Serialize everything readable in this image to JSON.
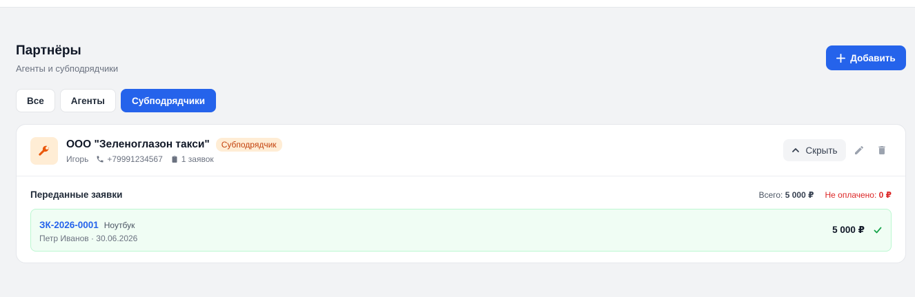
{
  "header": {
    "title": "Партнёры",
    "subtitle": "Агенты и субподрядчики",
    "add_label": "Добавить"
  },
  "tabs": [
    {
      "label": "Все",
      "active": false
    },
    {
      "label": "Агенты",
      "active": false
    },
    {
      "label": "Субподрядчики",
      "active": true
    }
  ],
  "partner": {
    "icon": "wrench-icon",
    "name": "ООО \"Зеленоглазон такси\"",
    "type_badge": "Субподрядчик",
    "contact": "Игорь",
    "phone": "+79991234567",
    "orders_count": "1 заявок",
    "hide_label": "Скрыть"
  },
  "orders_section": {
    "title": "Переданные заявки",
    "total_label": "Всего:",
    "total_value": "5 000 ₽",
    "unpaid_label": "Не оплачено:",
    "unpaid_value": "0 ₽"
  },
  "orders": [
    {
      "id": "ЗК-2026-0001",
      "device": "Ноутбук",
      "details": "Петр Иванов · 30.06.2026",
      "amount": "5 000 ₽",
      "status_icon": "check-icon"
    }
  ],
  "colors": {
    "accent": "#2563eb",
    "badge_bg": "#ffedd5",
    "badge_text": "#c2410c",
    "paid_bg": "#f0fdf4",
    "paid_border": "#bbf7d0",
    "unpaid": "#dc2626",
    "success": "#16a34a"
  }
}
